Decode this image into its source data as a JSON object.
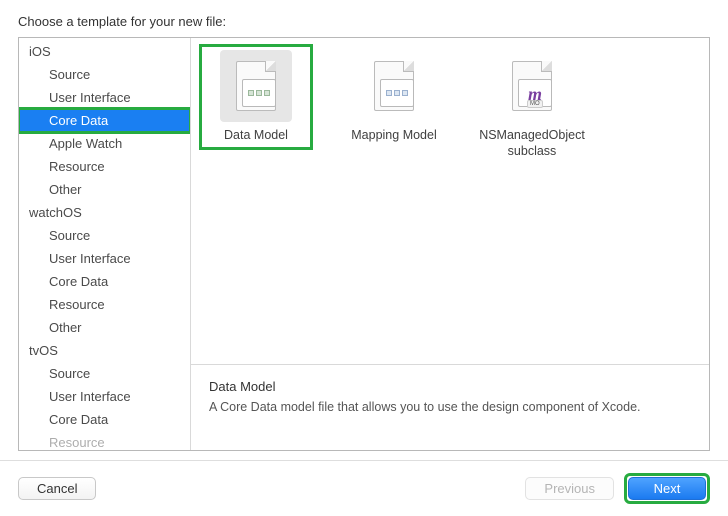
{
  "heading": "Choose a template for your new file:",
  "sidebar": {
    "platforms": [
      {
        "name": "iOS",
        "categories": [
          {
            "label": "Source",
            "selected": false
          },
          {
            "label": "User Interface",
            "selected": false
          },
          {
            "label": "Core Data",
            "selected": true
          },
          {
            "label": "Apple Watch",
            "selected": false
          },
          {
            "label": "Resource",
            "selected": false
          },
          {
            "label": "Other",
            "selected": false
          }
        ]
      },
      {
        "name": "watchOS",
        "categories": [
          {
            "label": "Source",
            "selected": false
          },
          {
            "label": "User Interface",
            "selected": false
          },
          {
            "label": "Core Data",
            "selected": false
          },
          {
            "label": "Resource",
            "selected": false
          },
          {
            "label": "Other",
            "selected": false
          }
        ]
      },
      {
        "name": "tvOS",
        "categories": [
          {
            "label": "Source",
            "selected": false
          },
          {
            "label": "User Interface",
            "selected": false
          },
          {
            "label": "Core Data",
            "selected": false
          },
          {
            "label": "Resource",
            "selected": false
          }
        ]
      }
    ]
  },
  "templates": [
    {
      "label": "Data Model",
      "selected": true,
      "highlighted": true
    },
    {
      "label": "Mapping Model",
      "selected": false,
      "highlighted": false
    },
    {
      "label": "NSManagedObject subclass",
      "selected": false,
      "highlighted": false
    }
  ],
  "description": {
    "title": "Data Model",
    "body": "A Core Data model file that allows you to use the design component of Xcode."
  },
  "footer": {
    "cancel": "Cancel",
    "previous": "Previous",
    "next": "Next"
  }
}
